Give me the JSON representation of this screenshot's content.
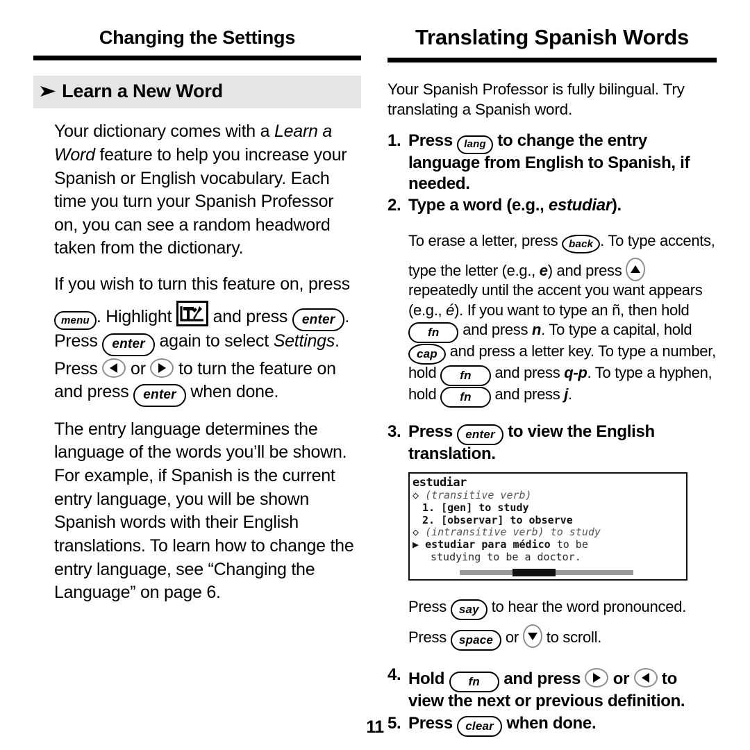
{
  "left": {
    "running_head": "Changing the Settings",
    "section": {
      "bullet": "➤",
      "title": "Learn a New Word"
    },
    "paragraphs": {
      "p1_a": "Your dictionary comes with a ",
      "p1_em": "Learn a Word",
      "p1_b": " feature to help you increase your Spanish or English vocabulary. Each time you turn your Spanish Professor on, you can see a random headword taken from the dictionary.",
      "p2_a": "If you wish to turn this feature on, press ",
      "p2_key_menu": "menu",
      "p2_b": ". Highlight ",
      "p2_icon": "tools-icon",
      "p2_c": " and press ",
      "p2_key_enter1": "enter",
      "p2_d": ". Press ",
      "p2_key_enter2": "enter",
      "p2_e": " again to select ",
      "p2_em": "Settings",
      "p2_f": ". Press ",
      "p2_arrow_left": "left-arrow-key",
      "p2_g": " or ",
      "p2_arrow_right": "right-arrow-key",
      "p2_h": " to turn the feature on and press ",
      "p2_key_enter3": "enter",
      "p2_i": " when done.",
      "p3": "The entry language determines the language of the words you’ll be shown.  For example, if Spanish is the current entry language, you will be shown Spanish words with their English translations. To learn how to change the entry language, see “Changing the Language” on page 6."
    }
  },
  "right": {
    "running_head": "Translating Spanish Words",
    "intro": "Your Spanish Professor is fully bilingual. Try translating a Spanish word.",
    "steps": {
      "s1_num": "1.",
      "s1_a": "Press ",
      "s1_key": "lang",
      "s1_b": " to change the entry language from English to Spanish, if needed.",
      "s2_num": "2.",
      "s2_a": "Type a word (e.g., ",
      "s2_em": "estudiar",
      "s2_b": ").",
      "s3_num": "3.",
      "s3_a": "Press ",
      "s3_key": "enter",
      "s3_b": " to view the English translation.",
      "s4_num": "4.",
      "s4_a": "Hold ",
      "s4_key": "fn",
      "s4_b": " and press ",
      "s4_arrow_right": "right-arrow-key",
      "s4_c": " or ",
      "s4_arrow_left": "left-arrow-key",
      "s4_d": " to view the next or previous definition.",
      "s5_num": "5.",
      "s5_a": "Press ",
      "s5_key": "clear",
      "s5_b": " when done."
    },
    "substep2": {
      "a": "To erase a letter, press ",
      "key_back": "back",
      "b": ". To type accents, type the letter (e.g., ",
      "em_e": "e",
      "c": ") and press ",
      "arrow_up": "up-arrow-key",
      "d": " repeatedly until the accent you want appears (e.g., ",
      "em_eacute": "é",
      "e": "). If you want to type an ñ, then hold ",
      "key_fn1": "fn",
      "f": " and press ",
      "em_n": "n",
      "g": ". To type a capital, hold ",
      "key_cap": "cap",
      "h": " and press a letter key. To type a number, hold ",
      "key_fn2": "fn",
      "i": " and press ",
      "em_qp": "q-p",
      "j": ". To type a hyphen, hold ",
      "key_fn3": "fn",
      "k": " and press ",
      "em_j": "j",
      "l": "."
    },
    "lcd": {
      "headword": "estudiar",
      "line2": "(transitive verb)",
      "line3": "1. [gen] to study",
      "line4": "2. [observar] to observe",
      "line5": "(intransitive verb) to study",
      "line6_es": "estudiar para médico",
      "line6_en": " to be",
      "line7": "studying to be a doctor.",
      "diamond": "◇",
      "pointer": "▶"
    },
    "after_lcd": {
      "a": "Press ",
      "key_say": "say",
      "b": " to hear the word pronounced.",
      "c": "Press ",
      "key_space": "space",
      "d": " or ",
      "arrow_down": "down-arrow-key",
      "e": " to scroll."
    }
  },
  "folio": "11",
  "colors": {
    "band_gray": "#e5e5e5",
    "rule_black": "#000000",
    "arrow_key_outline": "#8e8e8e"
  }
}
